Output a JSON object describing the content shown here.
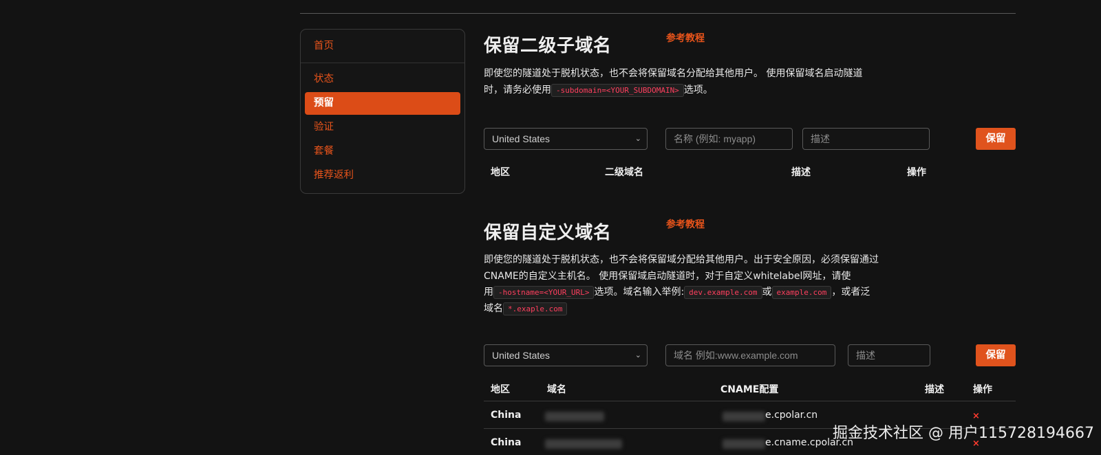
{
  "sidebar": {
    "items": [
      {
        "label": "首页"
      },
      {
        "label": "状态"
      },
      {
        "label": "预留"
      },
      {
        "label": "验证"
      },
      {
        "label": "套餐"
      },
      {
        "label": "推荐返利"
      }
    ]
  },
  "subdomain_section": {
    "title": "保留二级子域名",
    "tutorial": "参考教程",
    "desc_1": "即使您的隧道处于脱机状态，也不会将保留域名分配给其他用户。 使用保留域名启动隧道",
    "desc_2": "时，请务必使用",
    "code": "-subdomain=<YOUR_SUBDOMAIN>",
    "desc_3": "选项。",
    "region_select": "United States",
    "name_placeholder": "名称 (例如: myapp)",
    "desc_placeholder": "描述",
    "reserve_button": "保留",
    "columns": [
      "地区",
      "二级域名",
      "描述",
      "操作"
    ]
  },
  "custom_section": {
    "title": "保留自定义域名",
    "tutorial": "参考教程",
    "desc_1": "即使您的隧道处于脱机状态，也不会将保留域分配给其他用户。出于安全原因，必须保留通过",
    "desc_2": "CNAME的自定义主机名。 使用保留域启动隧道时，对于自定义whitelabel网址，请使",
    "desc_3a": "用",
    "code_hostname": "-hostname=<YOUR_URL>",
    "desc_3b": "选项。域名输入举例:",
    "code_example1": "dev.example.com",
    "desc_3c": "或",
    "code_example2": "example.com",
    "desc_3d": "，或者泛",
    "desc_4a": "域名",
    "code_wildcard": "*.exaple.com",
    "region_select": "United States",
    "domain_placeholder": "域名 例如:www.example.com",
    "desc_placeholder": "描述",
    "reserve_button": "保留",
    "columns": [
      "地区",
      "域名",
      "CNAME配置",
      "描述",
      "操作"
    ],
    "rows": [
      {
        "region": "China",
        "cname_suffix": "e.cpolar.cn",
        "delete": "×"
      },
      {
        "region": "China",
        "cname_suffix": "e.cname.cpolar.cn",
        "delete": "×"
      }
    ]
  },
  "watermark": "掘金技术社区 @ 用户115728194667"
}
